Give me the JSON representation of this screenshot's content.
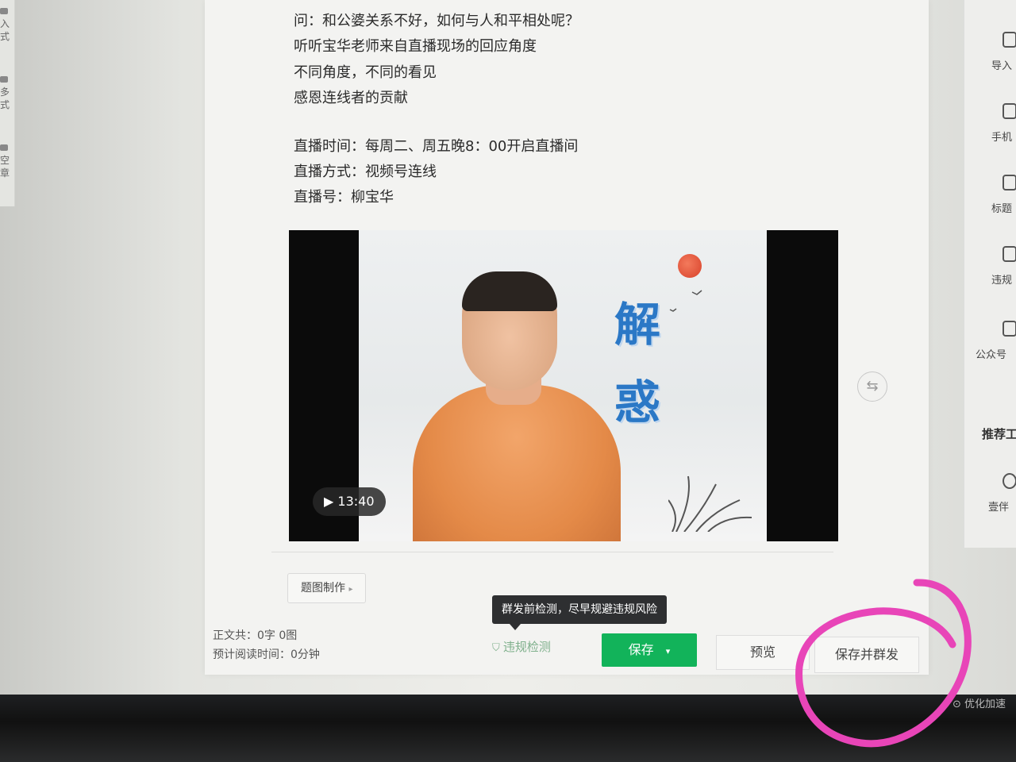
{
  "left_sidebar": {
    "items": [
      {
        "icon": "import-icon",
        "label": "入\n式"
      },
      {
        "icon": "multi-icon",
        "label": "多\n式"
      },
      {
        "icon": "empty-icon",
        "label": "空\n章"
      }
    ]
  },
  "article": {
    "lines_top": [
      "问：和公婆关系不好，如何与人和平相处呢？",
      "听听宝华老师来自直播现场的回应角度",
      "不同角度，不同的看见",
      "感恩连线者的贡献"
    ],
    "lines_live": [
      "直播时间：每周二、周五晚8：00开启直播间",
      "直播方式：视频号连线",
      "直播号：柳宝华"
    ]
  },
  "video": {
    "duration": "13:40",
    "title_chars": [
      "解",
      "惑"
    ]
  },
  "editor_footer": {
    "cover_button": "题图制作",
    "tooltip": "群发前检测，尽早规避违规风险",
    "word_count": "正文共：0字 0图",
    "reading_time": "预计阅读时间：0分钟",
    "violation_check": "违规检测",
    "save": "保存",
    "preview": "预览",
    "save_and_send": "保存并群发"
  },
  "right_toolbar": {
    "items": [
      {
        "icon": "import-doc-icon",
        "label": "导入"
      },
      {
        "icon": "phone-icon",
        "label": "手机"
      },
      {
        "icon": "title-icon",
        "label": "标题"
      },
      {
        "icon": "shield-icon",
        "label": "违规"
      },
      {
        "icon": "official-account-icon",
        "label": "公众号"
      }
    ],
    "recommend_title": "推荐工",
    "recommend_items": [
      {
        "icon": "partner-icon",
        "label": "壹伴"
      }
    ]
  },
  "optimize_text": "优化加速",
  "colors": {
    "primary": "#12b35a",
    "annotation": "#e845b8"
  }
}
